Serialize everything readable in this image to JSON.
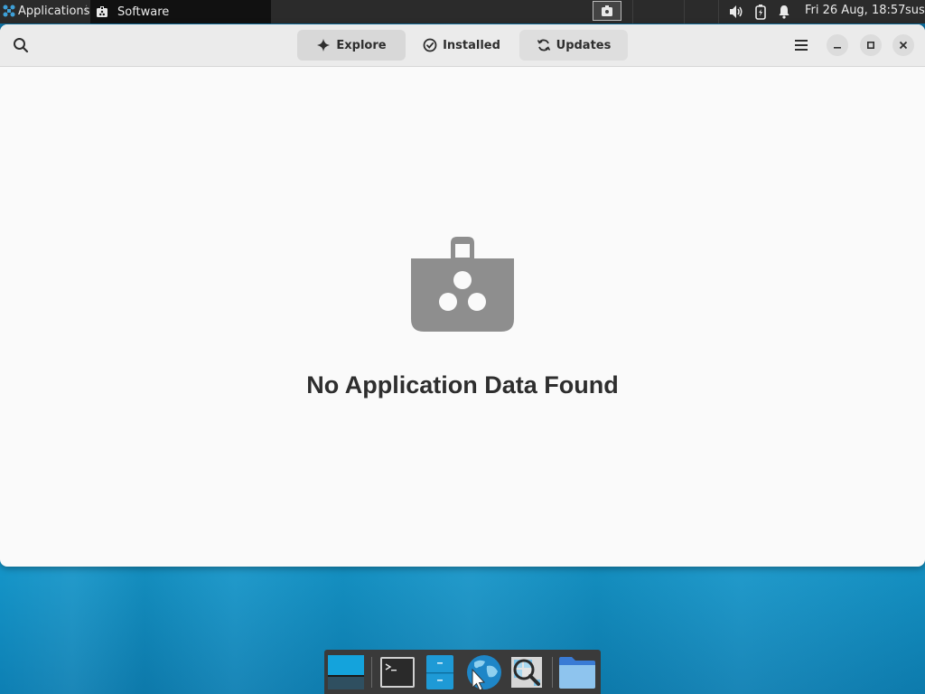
{
  "top_panel": {
    "apps_menu_label": "Applications",
    "task_label": "Software",
    "clock": "Fri 26 Aug, 18:57",
    "user": "sus"
  },
  "window": {
    "tabs": [
      {
        "label": "Explore",
        "icon": "star-sparkle-icon",
        "active": true
      },
      {
        "label": "Installed",
        "icon": "check-circle-icon",
        "active": false
      },
      {
        "label": "Updates",
        "icon": "refresh-icon",
        "active": false
      }
    ],
    "empty_state": {
      "title": "No Application Data Found",
      "icon": "shopping-bag-icon"
    }
  },
  "dock": {
    "items": [
      {
        "name": "show-desktop",
        "icon": "desktop-icon"
      },
      {
        "name": "terminal",
        "icon": "terminal-icon"
      },
      {
        "name": "file-manager",
        "icon": "file-cabinet-icon"
      },
      {
        "name": "web-browser",
        "icon": "globe-cursor-icon"
      },
      {
        "name": "app-finder",
        "icon": "magnifier-icon"
      },
      {
        "name": "home-folder",
        "icon": "folder-icon"
      }
    ]
  },
  "colors": {
    "panel": "#2b2b2b",
    "window_bg": "#fafafa",
    "headerbar": "#ebebeb",
    "icon_grey": "#8e8e8e",
    "desktop_accent": "#1aa3d6"
  }
}
